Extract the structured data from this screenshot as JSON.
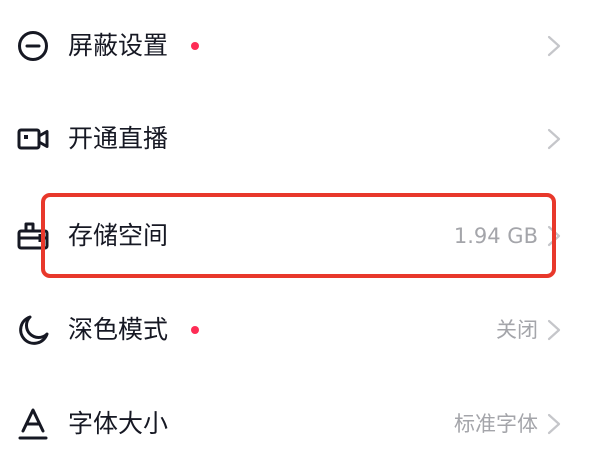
{
  "settings": {
    "items": [
      {
        "label": "屏蔽设置",
        "value": "",
        "has_dot": true,
        "icon": "minus-circle-icon"
      },
      {
        "label": "开通直播",
        "value": "",
        "has_dot": false,
        "icon": "video-camera-icon"
      },
      {
        "label": "存储空间",
        "value": "1.94 GB",
        "has_dot": false,
        "icon": "storage-box-icon"
      },
      {
        "label": "深色模式",
        "value": "关闭",
        "has_dot": true,
        "icon": "moon-icon"
      },
      {
        "label": "字体大小",
        "value": "标准字体",
        "has_dot": false,
        "icon": "font-size-icon"
      }
    ]
  },
  "colors": {
    "text_primary": "#161823",
    "text_secondary": "#a4a5aa",
    "dot": "#fe2c55",
    "highlight_border": "#e8382b",
    "chevron": "#c5c6ca"
  }
}
